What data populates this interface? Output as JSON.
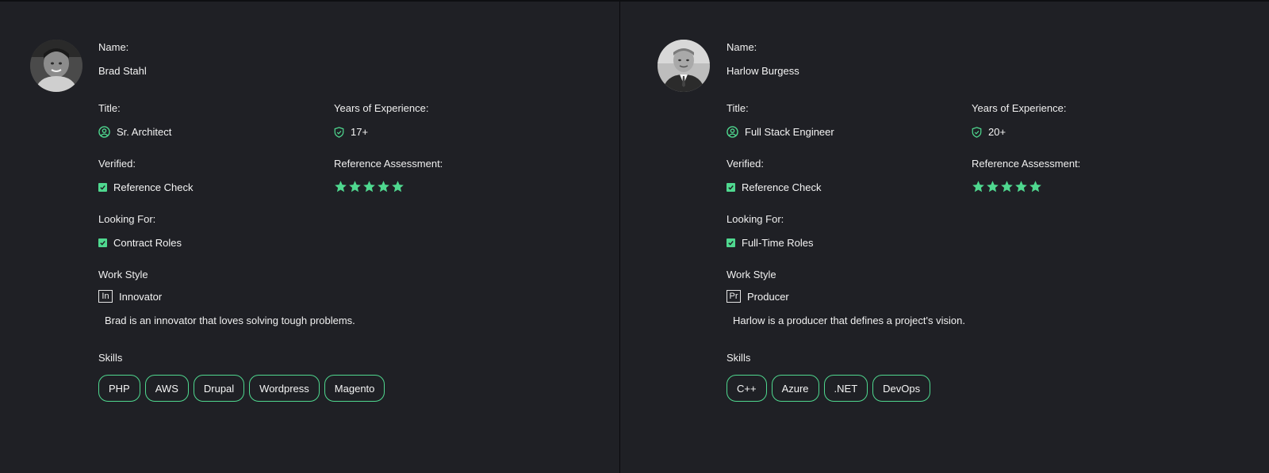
{
  "colors": {
    "background": "#1f2025",
    "accent": "#4fd88f",
    "text": "#f2f2f2"
  },
  "labels": {
    "name": "Name:",
    "title": "Title:",
    "years": "Years of Experience:",
    "verified": "Verified:",
    "reference_assessment": "Reference Assessment:",
    "looking_for": "Looking For:",
    "work_style": "Work Style",
    "skills": "Skills"
  },
  "candidates": [
    {
      "name": "Brad Stahl",
      "title": "Sr. Architect",
      "years": "17+",
      "verified": "Reference Check",
      "rating": 5,
      "looking_for": "Contract Roles",
      "work_style_abbr": "In",
      "work_style": "Innovator",
      "work_style_desc": "Brad is an innovator that loves solving tough problems.",
      "skills": [
        "PHP",
        "AWS",
        "Drupal",
        "Wordpress",
        "Magento"
      ],
      "icons": {
        "title": "user-circle-icon",
        "years": "shield-check-icon",
        "verified": "checkbox-checked-icon",
        "stars": "star-icon"
      }
    },
    {
      "name": "Harlow Burgess",
      "title": "Full Stack Engineer",
      "years": "20+",
      "verified": "Reference Check",
      "rating": 5,
      "looking_for": "Full-Time Roles",
      "work_style_abbr": "Pr",
      "work_style": "Producer",
      "work_style_desc": "Harlow is a producer that defines a project's vision.",
      "skills": [
        "C++",
        "Azure",
        ".NET",
        "DevOps"
      ],
      "icons": {
        "title": "user-circle-icon",
        "years": "shield-check-icon",
        "verified": "checkbox-checked-icon",
        "stars": "star-icon"
      }
    }
  ]
}
